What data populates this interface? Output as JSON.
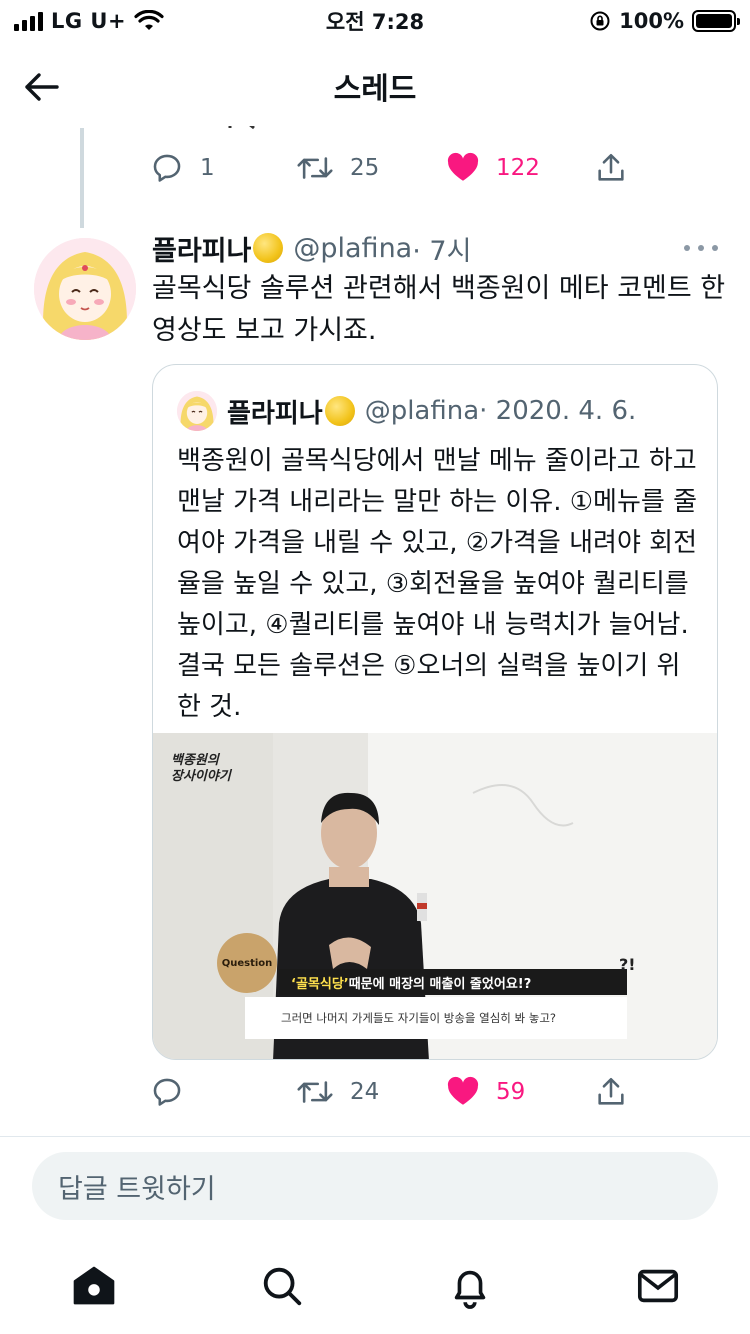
{
  "status_bar": {
    "carrier": "LG U+",
    "time": "오전 7:28",
    "battery": "100%"
  },
  "header": {
    "title": "스레드"
  },
  "prev_tweet": {
    "reply_count": "1",
    "retweet_count": "25",
    "like_count": "122"
  },
  "tweet": {
    "display_name": "플라피나",
    "handle": "@plafina",
    "time": "· 7시",
    "text": "골목식당 솔루션 관련해서 백종원이 메타 코멘트 한 영상도 보고 가시죠.",
    "reply_count": "",
    "retweet_count": "24",
    "like_count": "59",
    "quote": {
      "display_name": "플라피나",
      "handle": "@plafina",
      "date": "· 2020. 4. 6.",
      "text": "백종원이 골목식당에서 맨날 메뉴 줄이라고 하고 맨날 가격 내리라는 말만 하는 이유. ①메뉴를 줄여야 가격을 내릴 수 있고, ②가격을 내려야 회전율을 높일 수 있고, ③회전율을 높여야 퀄리티를 높이고, ④퀄리티를 높여야 내 능력치가 늘어남. 결국 모든 솔루션은 ⑤오너의 실력을 높이기 위한 것.",
      "media": {
        "brand_line1": "백종원의",
        "brand_line2": "장사이야기",
        "badge": "Question",
        "caption_highlight": "‘골목식당’",
        "caption_rest": " 때문에 매장의 매출이 줄었어요!?",
        "caption_marks": "?!",
        "subcaption": "그러면 나머지 가게들도 자기들이 방송을 열심히 봐 놓고?"
      }
    }
  },
  "reply_placeholder": "답글 트윗하기",
  "colors": {
    "like": "#f91880",
    "secondary": "#536471",
    "border": "#cfd9de"
  },
  "icons": [
    "back-arrow-icon",
    "reply-icon",
    "retweet-icon",
    "heart-icon",
    "share-icon",
    "more-icon",
    "home-icon",
    "search-icon",
    "bell-icon",
    "mail-icon"
  ]
}
